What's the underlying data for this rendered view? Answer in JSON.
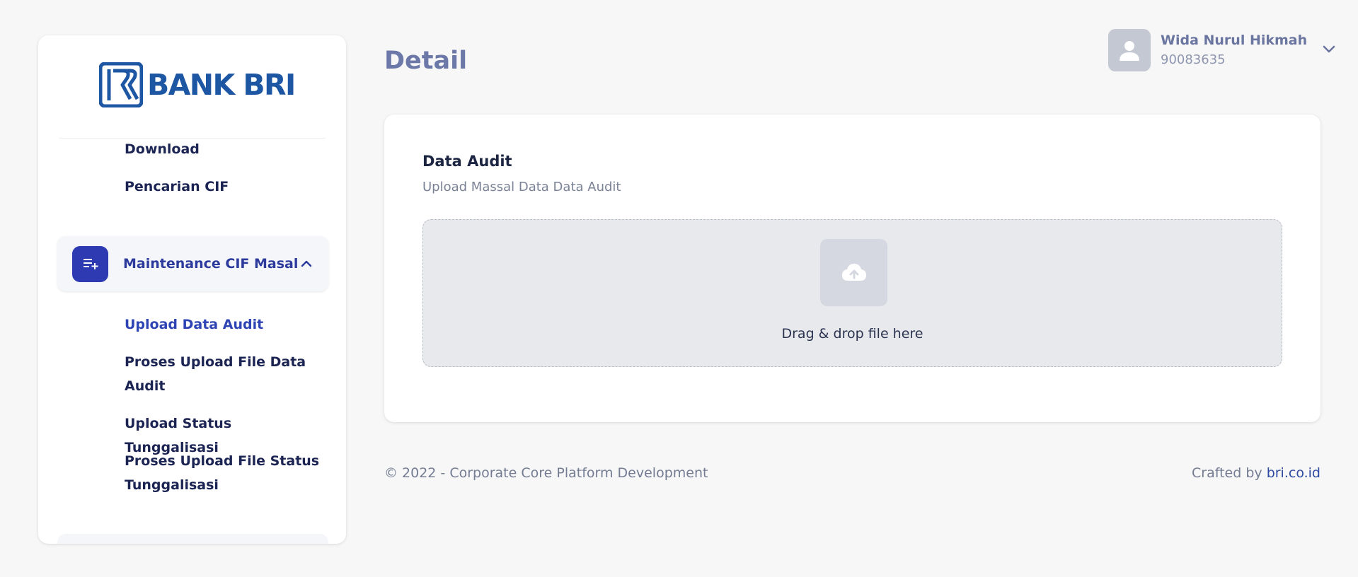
{
  "brand": {
    "logo_text": "BANK BRI",
    "color": "#1d56a3"
  },
  "sidebar": {
    "items_top": [
      {
        "label": "Download"
      },
      {
        "label": "Pencarian CIF"
      }
    ],
    "group": {
      "label": "Maintenance CIF Masal",
      "icon": "list-add-icon",
      "expanded": true,
      "items": [
        {
          "label": "Upload Data Audit",
          "active": true
        },
        {
          "label": "Proses Upload File Data Audit"
        },
        {
          "label": "Upload Status Tunggalisasi"
        },
        {
          "label": "Proses Upload File Status Tunggalisasi"
        }
      ]
    }
  },
  "header": {
    "title": "Detail",
    "user": {
      "name": "Wida Nurul Hikmah",
      "id": "90083635",
      "icon": "user-icon"
    }
  },
  "card": {
    "title": "Data Audit",
    "subtitle": "Upload Massal Data Data Audit",
    "dropzone": {
      "text": "Drag & drop file here",
      "icon": "cloud-upload-icon"
    }
  },
  "footer": {
    "copyright": "© 2022 - Corporate Core Platform Development",
    "crafted_prefix": "Crafted by ",
    "crafted_link": "bri.co.id"
  },
  "colors": {
    "accent": "#2d3ab1",
    "title": "#6b78a8",
    "background": "#f7f7f8"
  }
}
